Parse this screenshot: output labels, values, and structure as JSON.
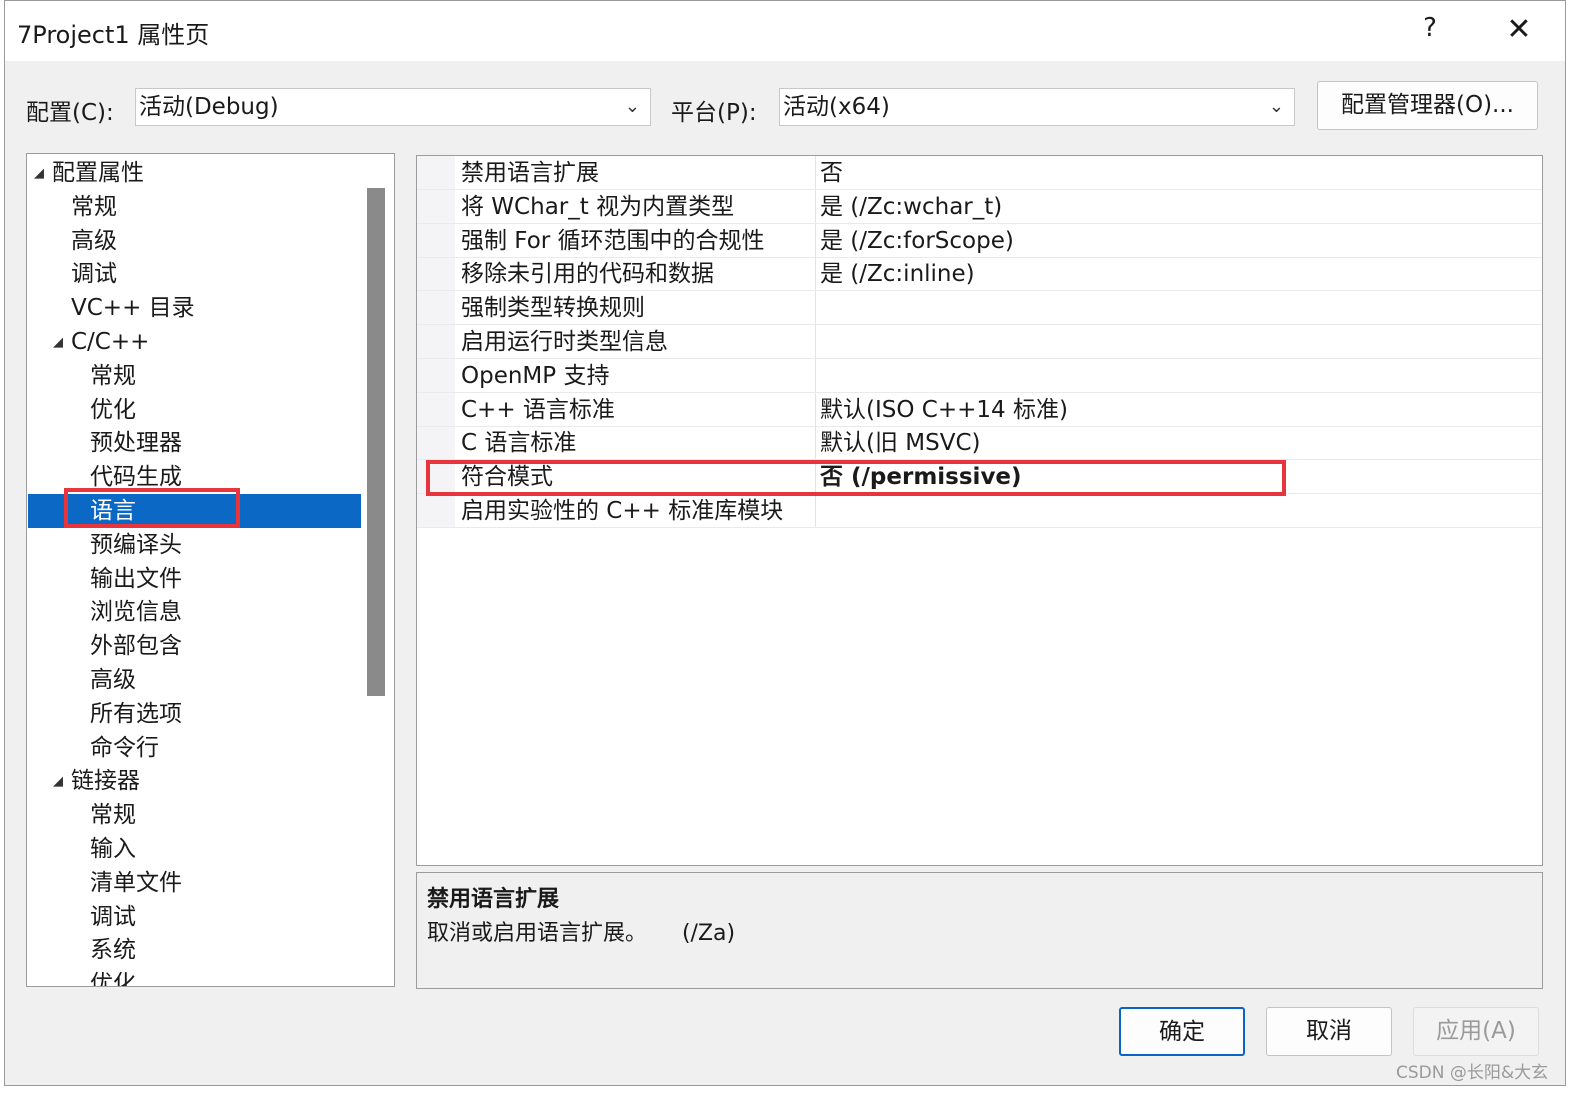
{
  "window": {
    "title": "7Project1 属性页",
    "help_glyph": "?",
    "close_glyph": "✕"
  },
  "toolbar": {
    "config_label": "配置(C):",
    "config_value": "活动(Debug)",
    "platform_label": "平台(P):",
    "platform_value": "活动(x64)",
    "config_manager_label": "配置管理器(O)..."
  },
  "tree": {
    "items": [
      {
        "label": "配置属性",
        "expanded": true
      },
      {
        "label": "常规"
      },
      {
        "label": "高级"
      },
      {
        "label": "调试"
      },
      {
        "label": "VC++ 目录"
      },
      {
        "label": "C/C++",
        "expanded": true
      },
      {
        "label": "常规"
      },
      {
        "label": "优化"
      },
      {
        "label": "预处理器"
      },
      {
        "label": "代码生成"
      },
      {
        "label": "语言",
        "selected": true
      },
      {
        "label": "预编译头"
      },
      {
        "label": "输出文件"
      },
      {
        "label": "浏览信息"
      },
      {
        "label": "外部包含"
      },
      {
        "label": "高级"
      },
      {
        "label": "所有选项"
      },
      {
        "label": "命令行"
      },
      {
        "label": "链接器",
        "expanded": true
      },
      {
        "label": "常规"
      },
      {
        "label": "输入"
      },
      {
        "label": "清单文件"
      },
      {
        "label": "调试"
      },
      {
        "label": "系统"
      },
      {
        "label": "优化"
      }
    ]
  },
  "grid": {
    "rows": [
      {
        "name": "禁用语言扩展",
        "value": "否"
      },
      {
        "name": "将 WChar_t 视为内置类型",
        "value": "是 (/Zc:wchar_t)"
      },
      {
        "name": "强制 For 循环范围中的合规性",
        "value": "是 (/Zc:forScope)"
      },
      {
        "name": "移除未引用的代码和数据",
        "value": "是 (/Zc:inline)"
      },
      {
        "name": "强制类型转换规则",
        "value": ""
      },
      {
        "name": "启用运行时类型信息",
        "value": ""
      },
      {
        "name": "OpenMP 支持",
        "value": ""
      },
      {
        "name": "C++ 语言标准",
        "value": "默认(ISO C++14 标准)"
      },
      {
        "name": "C 语言标准",
        "value": "默认(旧 MSVC)"
      },
      {
        "name": "符合模式",
        "value": "否 (/permissive)",
        "bold": true
      },
      {
        "name": "启用实验性的 C++ 标准库模块",
        "value": ""
      }
    ]
  },
  "description": {
    "title": "禁用语言扩展",
    "text": "取消或启用语言扩展。     (/Za)"
  },
  "buttons": {
    "ok": "确定",
    "cancel": "取消",
    "apply": "应用(A)"
  },
  "watermark": "CSDN @长阳&大玄",
  "colors": {
    "selection": "#0c68c5",
    "highlight": "#e8343c",
    "ok_border": "#0a64c8"
  }
}
